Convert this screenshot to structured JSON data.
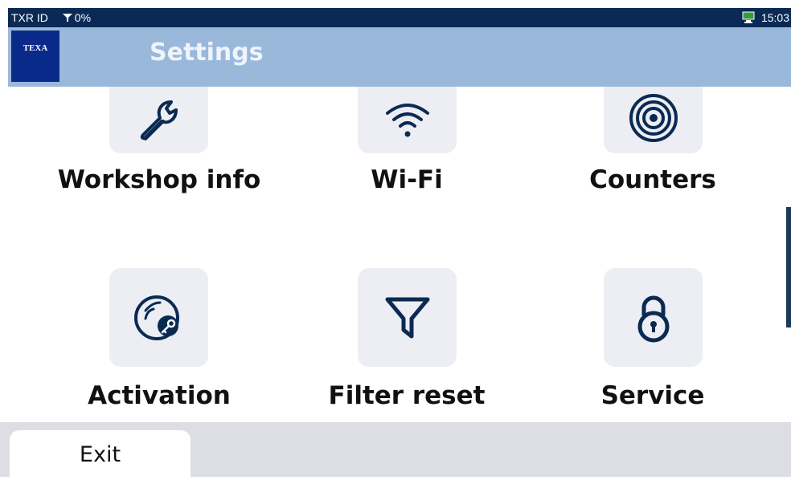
{
  "statusbar": {
    "device_id": "TXR ID",
    "signal": "0%",
    "time": "15:03"
  },
  "header": {
    "logo_text": "TEXA",
    "title": "Settings"
  },
  "tiles": [
    {
      "label": "Workshop info",
      "icon": "wrench-icon"
    },
    {
      "label": "Wi-Fi",
      "icon": "wifi-icon"
    },
    {
      "label": "Counters",
      "icon": "target-icon"
    },
    {
      "label": "Activation",
      "icon": "activation-icon"
    },
    {
      "label": "Filter reset",
      "icon": "filter-icon"
    },
    {
      "label": "Service",
      "icon": "padlock-icon"
    }
  ],
  "footer": {
    "exit_label": "Exit"
  },
  "colors": {
    "statusbar": "#0a2a55",
    "header": "#9ab8d9",
    "icon": "#0b2a52",
    "tile_bg": "#eceef3"
  }
}
